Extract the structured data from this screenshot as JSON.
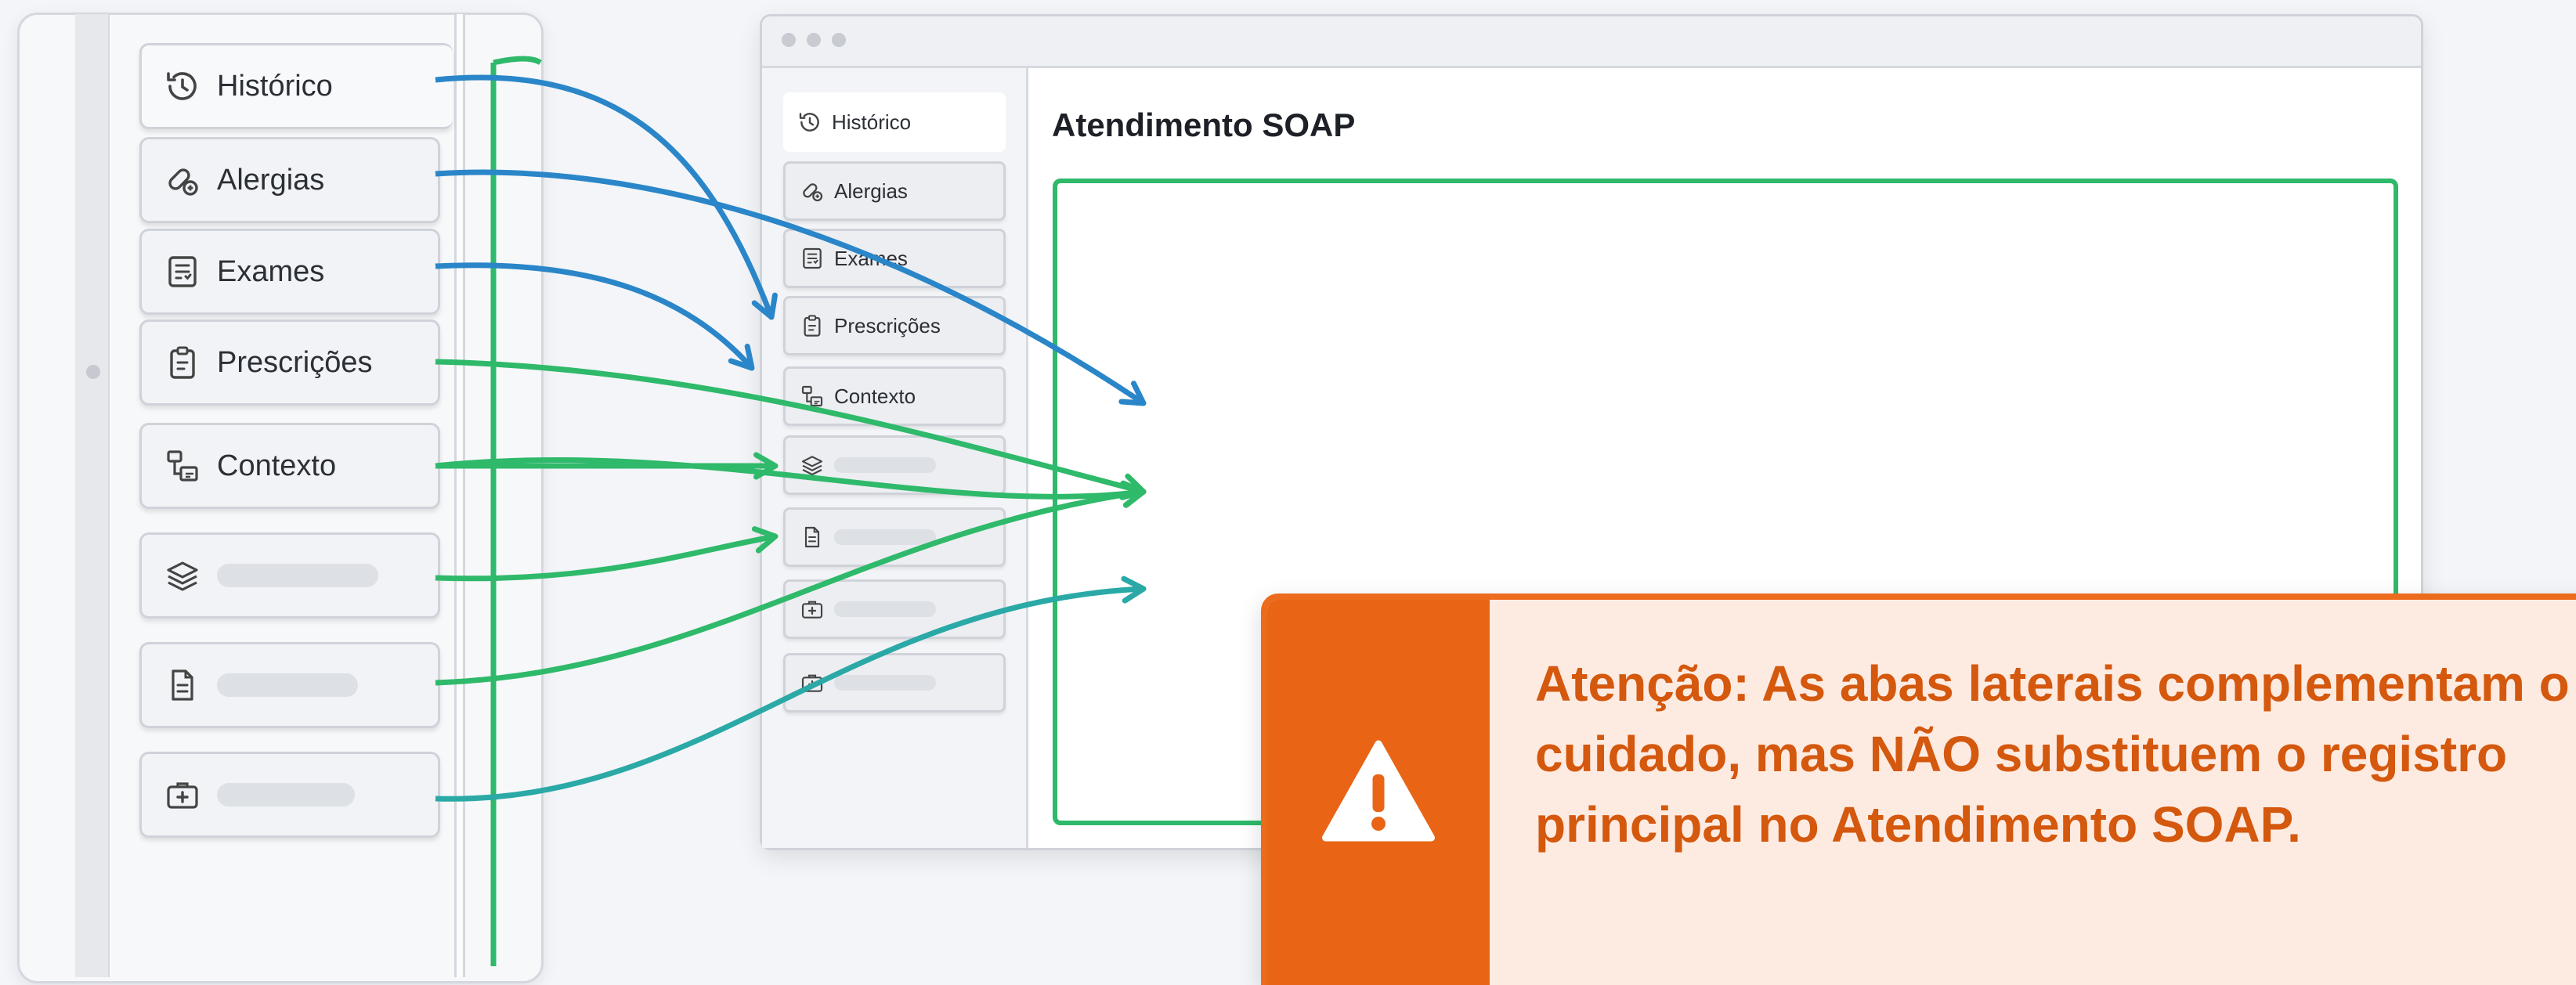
{
  "sidebar": {
    "tabs": [
      {
        "label": "Histórico",
        "icon": "history-icon"
      },
      {
        "label": "Alergias",
        "icon": "allergy-icon"
      },
      {
        "label": "Exames",
        "icon": "exams-icon"
      },
      {
        "label": "Prescrições",
        "icon": "clipboard-icon"
      },
      {
        "label": "Contexto",
        "icon": "context-icon"
      },
      {
        "label": "",
        "icon": "layers-icon"
      },
      {
        "label": "",
        "icon": "document-icon"
      },
      {
        "label": "",
        "icon": "medical-kit-icon"
      }
    ]
  },
  "window": {
    "title": "Atendimento SOAP",
    "tabs": [
      {
        "label": "Histórico",
        "icon": "history-icon"
      },
      {
        "label": "Alergias",
        "icon": "allergy-icon"
      },
      {
        "label": "Exames",
        "icon": "exams-icon"
      },
      {
        "label": "Prescrições",
        "icon": "clipboard-icon"
      },
      {
        "label": "Contexto",
        "icon": "context-icon"
      },
      {
        "label": "",
        "icon": "layers-icon"
      },
      {
        "label": "",
        "icon": "document-icon"
      },
      {
        "label": "",
        "icon": "medical-kit-icon"
      },
      {
        "label": "",
        "icon": "medical-kit-icon"
      }
    ]
  },
  "warning": {
    "text": "Atenção: As abas laterais complementam o cuidado, mas NÃO substituem o registro principal no Atendimento SOAP.",
    "icon": "warning-icon"
  },
  "colors": {
    "blue_arrow": "#2a86c8",
    "green_arrow": "#2fb96a",
    "teal_arrow": "#2aa9a6",
    "warning_orange": "#ea6415",
    "warning_bg": "#fdebe2"
  }
}
